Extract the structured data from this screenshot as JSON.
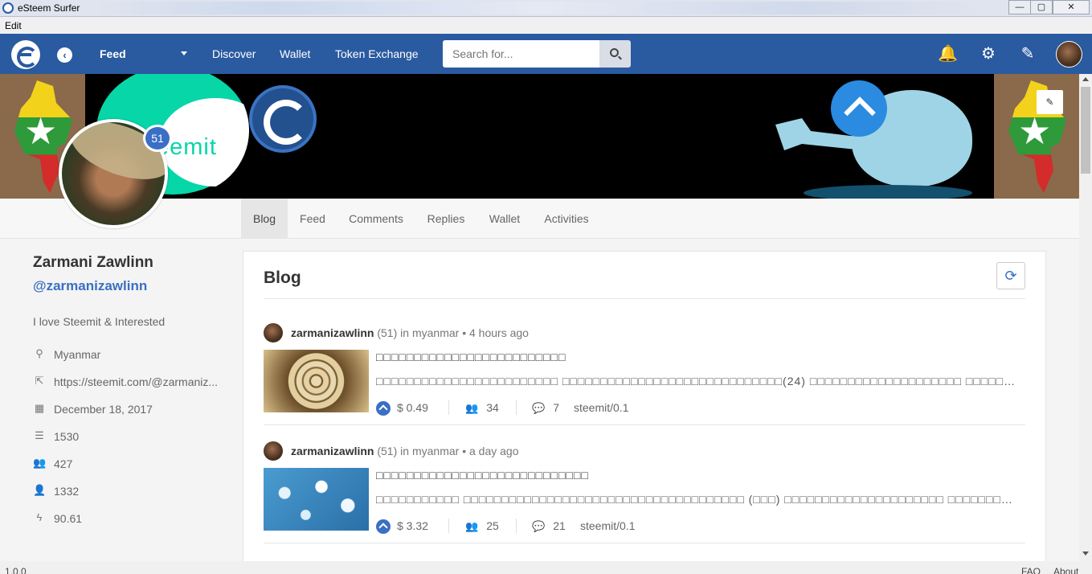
{
  "window": {
    "title": "eSteem Surfer",
    "minimize": "—",
    "maximize": "▢",
    "close": "✕"
  },
  "menu": {
    "edit": "Edit"
  },
  "nav": {
    "back": "‹",
    "feed": "Feed",
    "discover": "Discover",
    "wallet": "Wallet",
    "token_exchange": "Token Exchange",
    "search_placeholder": "Search for...",
    "bell": "🔔",
    "gear": "⚙",
    "pencil": "✎"
  },
  "cover": {
    "steemit_text": "eemit",
    "edit_icon": "✎"
  },
  "profile": {
    "reputation": "51",
    "name": "Zarmani Zawlinn",
    "handle": "@zarmanizawlinn",
    "about": "I love Steemit & Interested",
    "location": "Myanmar",
    "website": "https://steemit.com/@zarmaniz...",
    "joined": "December 18, 2017",
    "posts": "1530",
    "followers": "427",
    "following": "1332",
    "voting_power": "90.61"
  },
  "icons": {
    "location": "⚲",
    "website": "⇱",
    "joined": "▦",
    "posts": "☰",
    "followers": "👥",
    "following": "👤",
    "voting_power": "ϟ",
    "refresh": "⟳",
    "votes": "👥",
    "comments": "💬"
  },
  "tabs": [
    "Blog",
    "Feed",
    "Comments",
    "Replies",
    "Wallet",
    "Activities"
  ],
  "content": {
    "title": "Blog"
  },
  "posts": [
    {
      "author": "zarmanizawlinn",
      "rep": "(51)",
      "in": "in",
      "category": "myanmar",
      "dot": "•",
      "time": "4 hours ago",
      "title": "□□□□□□□□□□□□□□□□□□□□□□□□□",
      "body": "□□□□□□□□□□□□□□□□□□□□□□□□ □□□□□□□□□□□□□□□□□□□□□□□□□□□□□(24) □□□□□□□□□□□□□□□□□□□□ □□□□□□...",
      "payout": "$ 0.49",
      "votes": "34",
      "comments": "7",
      "app": "steemit/0.1"
    },
    {
      "author": "zarmanizawlinn",
      "rep": "(51)",
      "in": "in",
      "category": "myanmar",
      "dot": "•",
      "time": "a day ago",
      "title": "□□□□□□□□□□□□□□□□□□□□□□□□□□□□",
      "body": "□□□□□□□□□□□ □□□□□□□□□□□□□□□□□□□□□□□□□□□□□□□□□□□□□ (□□□) □□□□□□□□□□□□□□□□□□□□□ □□□□□□□□□□□□...",
      "payout": "$ 3.32",
      "votes": "25",
      "comments": "21",
      "app": "steemit/0.1"
    }
  ],
  "status": {
    "version": "1.0.0",
    "faq": "FAQ",
    "about": "About"
  }
}
